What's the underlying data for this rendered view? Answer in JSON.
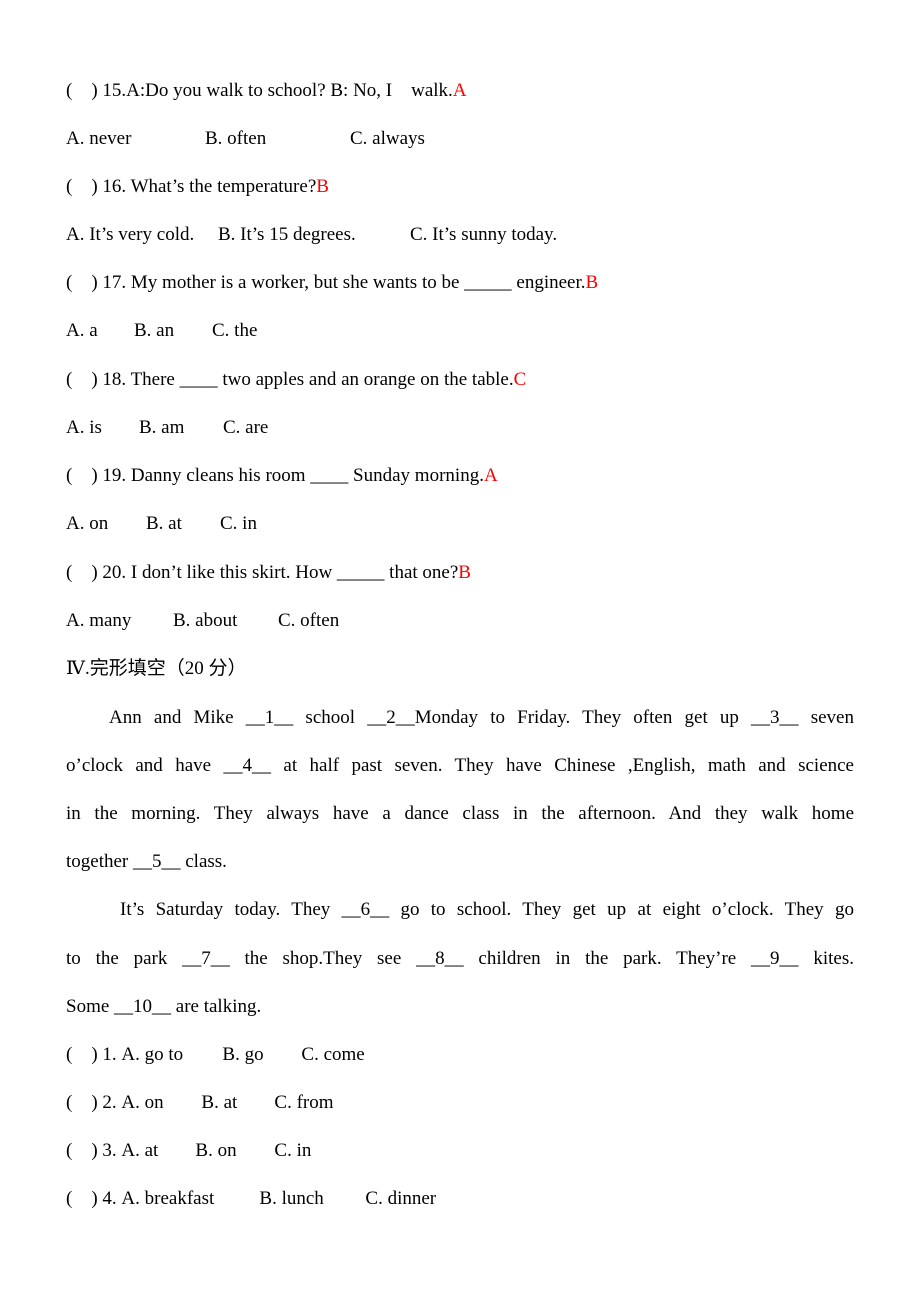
{
  "questions": [
    {
      "paren": "(    )",
      "stem": " 15.A:Do you walk to school? B: No, I    walk.",
      "answer": "A",
      "options": [
        "A. never",
        "B. often",
        "C. always"
      ]
    },
    {
      "paren": "(    )",
      "stem": " 16. What’s the temperature?",
      "answer": "B",
      "options": [
        "A. It’s very cold.",
        "B. It’s 15 degrees.",
        "C. It’s sunny today."
      ]
    },
    {
      "paren": "(    )",
      "stem": " 17. My mother is a worker, but she wants to be _____ engineer.",
      "answer": "B",
      "options": [
        "A. a",
        "B. an",
        "C. the"
      ]
    },
    {
      "paren": "(    )",
      "stem": " 18. There ____ two apples and an orange on the table.",
      "answer": "C",
      "options": [
        "A. is",
        "B. am",
        "C. are"
      ]
    },
    {
      "paren": "(    )",
      "stem": " 19. Danny cleans his room ____ Sunday morning.",
      "answer": "A",
      "options": [
        "A. on",
        "B. at",
        "C. in"
      ]
    },
    {
      "paren": "(    )",
      "stem": " 20. I don’t like this skirt. How _____ that one?",
      "answer": "B",
      "options": [
        "A. many",
        "B. about",
        "C. often"
      ]
    }
  ],
  "section": {
    "title": "Ⅳ.完形填空（20 分）"
  },
  "passage": {
    "lines": [
      "Ann and Mike __1__ school __2__Monday to Friday. They often get up __3__ seven",
      "o’clock and have __4__ at half past seven. They have Chinese ,English, math and science",
      "in the morning. They always have a dance class in the afternoon. And they walk home",
      "together __5__ class.",
      "It’s Saturday today. They __6__ go to school. They get up at eight o’clock. They go",
      "to the park __7__ the shop.They see __8__ children in the park. They’re __9__ kites.",
      "Some __10__ are talking."
    ]
  },
  "cloze": [
    {
      "paren": "(    )",
      "num": " 1.",
      "options": [
        "A. go to",
        "B. go",
        "C. come"
      ]
    },
    {
      "paren": "(    )",
      "num": " 2.",
      "options": [
        "A. on",
        "B. at",
        "C. from"
      ]
    },
    {
      "paren": "(    )",
      "num": " 3.",
      "options": [
        "A. at",
        "B. on",
        "C. in"
      ]
    },
    {
      "paren": "(    )",
      "num": " 4.",
      "options": [
        "A. breakfast",
        "B. lunch",
        "C. dinner"
      ]
    }
  ]
}
